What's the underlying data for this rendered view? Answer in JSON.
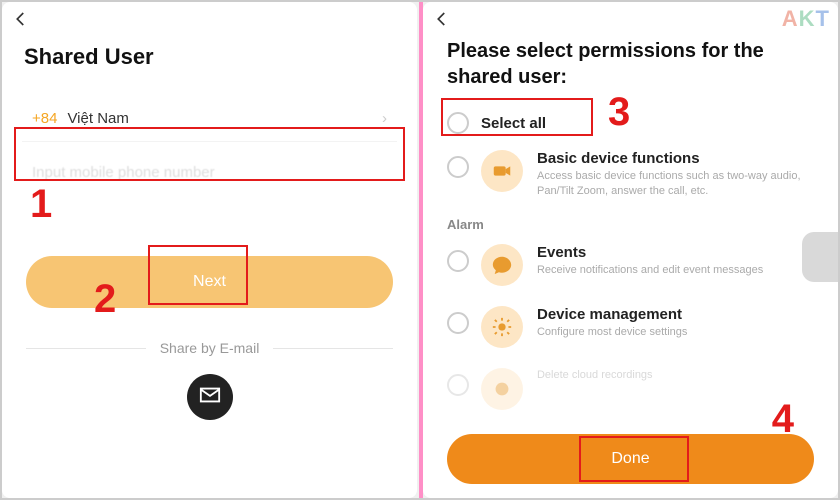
{
  "left": {
    "title": "Shared User",
    "country_code": "+84",
    "country_name": "Việt Nam",
    "phone_placeholder": "Input mobile phone number",
    "next_label": "Next",
    "divider_label": "Share by E-mail"
  },
  "right": {
    "title": "Please select permissions for the shared user:",
    "select_all_label": "Select all",
    "section_alarm": "Alarm",
    "perm_basic_title": "Basic device functions",
    "perm_basic_desc": "Access basic device functions such as two-way audio, Pan/Tilt Zoom, answer the call, etc.",
    "perm_events_title": "Events",
    "perm_events_desc": "Receive notifications and edit event messages",
    "perm_device_title": "Device management",
    "perm_device_desc": "Configure most device settings",
    "perm_cloud_desc": "Delete cloud recordings",
    "done_label": "Done"
  },
  "annotations": {
    "n1": "1",
    "n2": "2",
    "n3": "3",
    "n4": "4"
  },
  "watermark": {
    "a": "A",
    "k": "K",
    "t": "T"
  }
}
